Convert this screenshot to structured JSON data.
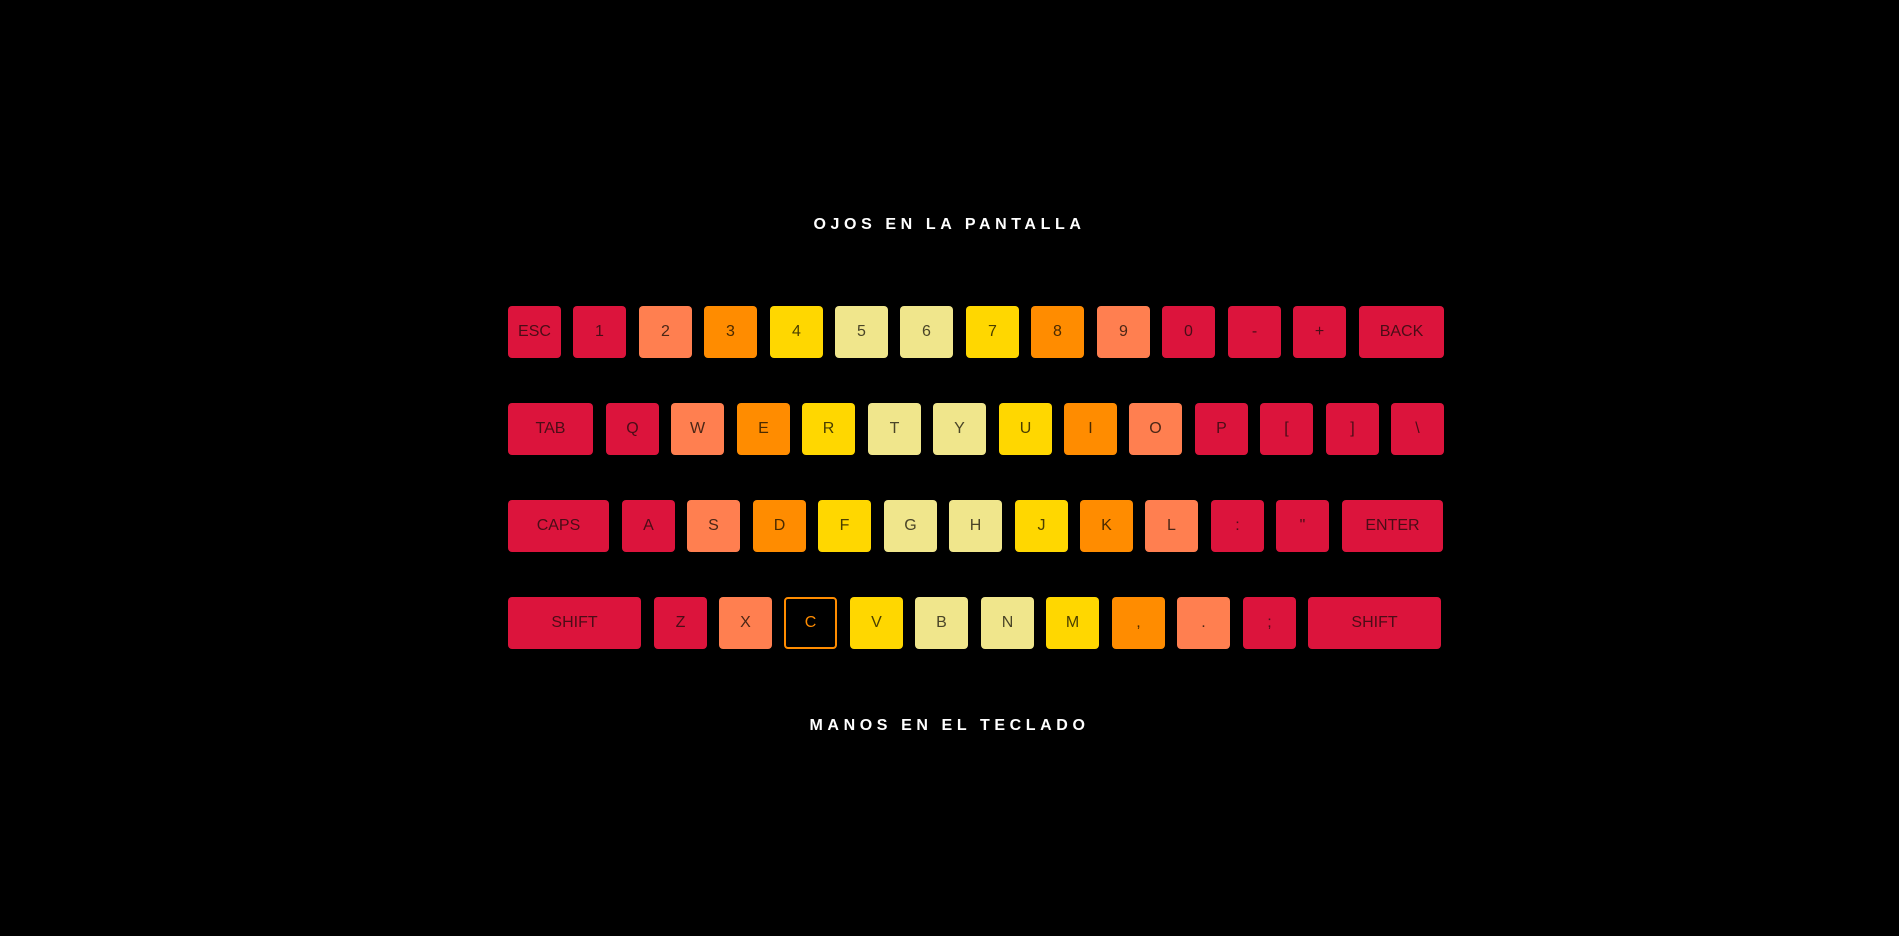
{
  "headings": {
    "top": "OJOS EN LA PANTALLA",
    "bottom": "MANOS EN EL TECLADO"
  },
  "colors": {
    "background": "#000000",
    "crimson": "#dc143c",
    "coral": "#ff7f50",
    "orange": "#ff8c00",
    "gold": "#ffd700",
    "khaki": "#f0e68c",
    "active_border": "#ff8c00"
  },
  "keyboard": {
    "rows": [
      {
        "keys": [
          {
            "label": "ESC",
            "color": "crimson"
          },
          {
            "label": "1",
            "color": "crimson"
          },
          {
            "label": "2",
            "color": "coral"
          },
          {
            "label": "3",
            "color": "orange"
          },
          {
            "label": "4",
            "color": "gold"
          },
          {
            "label": "5",
            "color": "khaki"
          },
          {
            "label": "6",
            "color": "khaki"
          },
          {
            "label": "7",
            "color": "gold"
          },
          {
            "label": "8",
            "color": "orange"
          },
          {
            "label": "9",
            "color": "coral"
          },
          {
            "label": "0",
            "color": "crimson"
          },
          {
            "label": "-",
            "color": "crimson"
          },
          {
            "label": "+",
            "color": "crimson"
          },
          {
            "label": "BACK",
            "color": "crimson"
          }
        ]
      },
      {
        "keys": [
          {
            "label": "TAB",
            "color": "crimson"
          },
          {
            "label": "Q",
            "color": "crimson"
          },
          {
            "label": "W",
            "color": "coral"
          },
          {
            "label": "E",
            "color": "orange"
          },
          {
            "label": "R",
            "color": "gold"
          },
          {
            "label": "T",
            "color": "khaki"
          },
          {
            "label": "Y",
            "color": "khaki"
          },
          {
            "label": "U",
            "color": "gold"
          },
          {
            "label": "I",
            "color": "orange"
          },
          {
            "label": "O",
            "color": "coral"
          },
          {
            "label": "P",
            "color": "crimson"
          },
          {
            "label": "[",
            "color": "crimson"
          },
          {
            "label": "]",
            "color": "crimson"
          },
          {
            "label": "\\",
            "color": "crimson"
          }
        ]
      },
      {
        "keys": [
          {
            "label": "CAPS",
            "color": "crimson"
          },
          {
            "label": "A",
            "color": "crimson"
          },
          {
            "label": "S",
            "color": "coral"
          },
          {
            "label": "D",
            "color": "orange"
          },
          {
            "label": "F",
            "color": "gold"
          },
          {
            "label": "G",
            "color": "khaki"
          },
          {
            "label": "H",
            "color": "khaki"
          },
          {
            "label": "J",
            "color": "gold"
          },
          {
            "label": "K",
            "color": "orange"
          },
          {
            "label": "L",
            "color": "coral"
          },
          {
            "label": ":",
            "color": "crimson"
          },
          {
            "label": "\"",
            "color": "crimson"
          },
          {
            "label": "ENTER",
            "color": "crimson"
          }
        ]
      },
      {
        "keys": [
          {
            "label": "SHIFT",
            "color": "crimson"
          },
          {
            "label": "Z",
            "color": "crimson"
          },
          {
            "label": "X",
            "color": "coral"
          },
          {
            "label": "C",
            "color": "active"
          },
          {
            "label": "V",
            "color": "gold"
          },
          {
            "label": "B",
            "color": "khaki"
          },
          {
            "label": "N",
            "color": "khaki"
          },
          {
            "label": "M",
            "color": "gold"
          },
          {
            "label": ",",
            "color": "orange"
          },
          {
            "label": ".",
            "color": "coral"
          },
          {
            "label": ";",
            "color": "crimson"
          },
          {
            "label": "SHIFT",
            "color": "crimson"
          }
        ]
      }
    ]
  }
}
